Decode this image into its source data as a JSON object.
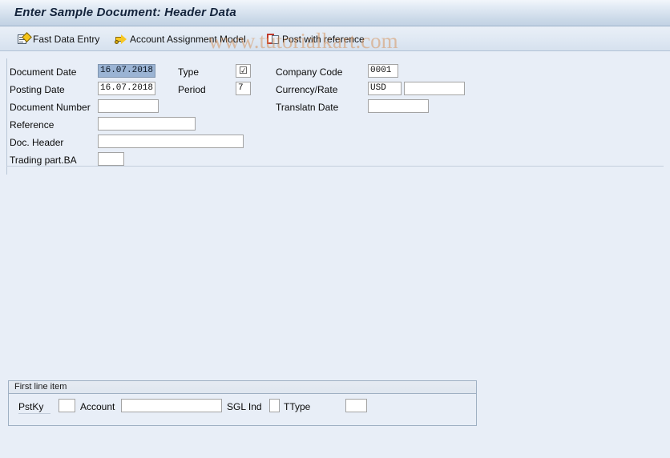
{
  "window": {
    "title": "Enter Sample Document: Header Data"
  },
  "watermark": {
    "text": "www.tutorialkart.com"
  },
  "toolbar": {
    "buttons": [
      {
        "label": "Fast Data Entry",
        "icon": "fast-data-entry-icon"
      },
      {
        "label": "Account Assignment Model",
        "icon": "account-assignment-model-icon"
      },
      {
        "label": "Post with reference",
        "icon": "post-with-reference-icon"
      }
    ]
  },
  "header_form": {
    "left_column": [
      {
        "label": "Document Date",
        "value": "16.07.2018",
        "selected": true
      },
      {
        "label": "Posting Date",
        "value": "16.07.2018",
        "selected": false
      },
      {
        "label": "Document Number",
        "value": "",
        "selected": false
      },
      {
        "label": "Reference",
        "value": "",
        "selected": false
      },
      {
        "label": "Doc. Header",
        "value": "",
        "selected": false
      },
      {
        "label": "Trading part.BA",
        "value": "",
        "selected": false
      }
    ],
    "middle_column": [
      {
        "label": "Type",
        "value": "☑",
        "selected": false
      },
      {
        "label": "Period",
        "value": "7",
        "selected": false
      }
    ],
    "right_column": [
      {
        "label": "Company Code",
        "value": "0001",
        "selected": false
      },
      {
        "label": "Currency/Rate",
        "value": "USD",
        "rate_value": "",
        "selected": false
      },
      {
        "label": "Translatn Date",
        "value": "",
        "selected": false
      }
    ]
  },
  "first_line_item": {
    "group_title": "First line item",
    "fields": [
      {
        "label": "PstKy",
        "value": ""
      },
      {
        "label": "Account",
        "value": ""
      },
      {
        "label": "SGL Ind",
        "value": ""
      },
      {
        "label": "TType",
        "value": ""
      }
    ]
  },
  "colors": {
    "page_background": "#E8EEF7",
    "titlebar_accent": "#C2D2E4",
    "selected_field": "#9BB4D4",
    "watermark": "#D68E52"
  }
}
